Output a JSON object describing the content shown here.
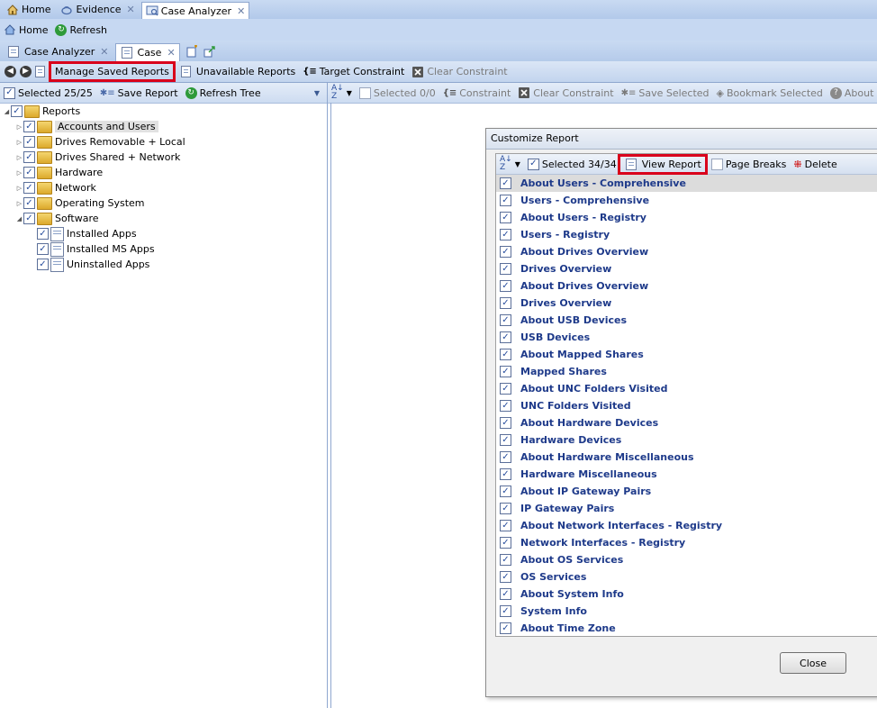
{
  "tabs_top": [
    {
      "label": "Home",
      "icon": "home-icon",
      "closable": false,
      "active": false
    },
    {
      "label": "Evidence",
      "icon": "evidence-icon",
      "closable": true,
      "active": false
    },
    {
      "label": "Case Analyzer",
      "icon": "case-analyzer-icon",
      "closable": true,
      "active": true
    }
  ],
  "home_toolbar": {
    "home_label": "Home",
    "refresh_label": "Refresh"
  },
  "inner_tabs": [
    {
      "label": "Case Analyzer",
      "closable": true
    },
    {
      "label": "Case",
      "closable": true
    }
  ],
  "nav_toolbar": {
    "manage_saved_reports": "Manage Saved Reports",
    "unavailable_reports": "Unavailable Reports",
    "target_constraint": "Target Constraint",
    "clear_constraint": "Clear Constraint"
  },
  "left_toolbar": {
    "selected": "Selected 25/25",
    "save_report": "Save Report",
    "refresh_tree": "Refresh Tree"
  },
  "tree": {
    "root": "Reports",
    "items": [
      {
        "label": "Accounts and Users",
        "selected": true
      },
      {
        "label": "Drives Removable + Local"
      },
      {
        "label": "Drives Shared + Network"
      },
      {
        "label": "Hardware"
      },
      {
        "label": "Network"
      },
      {
        "label": "Operating System"
      },
      {
        "label": "Software"
      }
    ],
    "software_children": [
      "Installed Apps",
      "Installed MS Apps",
      "Uninstalled Apps"
    ]
  },
  "right_toolbar": {
    "selected": "Selected 0/0",
    "constraint": "Constraint",
    "clear_constraint": "Clear Constraint",
    "save_selected": "Save Selected",
    "bookmark_selected": "Bookmark Selected",
    "about": "About"
  },
  "dialog": {
    "title": "Customize Report",
    "selected": "Selected 34/34",
    "view_report": "View Report",
    "page_breaks": "Page Breaks",
    "delete": "Delete",
    "close": "Close",
    "items": [
      "About Users - Comprehensive",
      "Users - Comprehensive",
      "About Users - Registry",
      "Users - Registry",
      "About Drives Overview",
      "Drives Overview",
      "About Drives Overview",
      "Drives Overview",
      "About USB Devices",
      "USB Devices",
      "About Mapped Shares",
      "Mapped Shares",
      "About UNC Folders Visited",
      "UNC Folders Visited",
      "About Hardware Devices",
      "Hardware Devices",
      "About Hardware Miscellaneous",
      "Hardware Miscellaneous",
      "About IP Gateway Pairs",
      "IP Gateway Pairs",
      "About Network Interfaces - Registry",
      "Network Interfaces - Registry",
      "About OS Services",
      "OS Services",
      "About System Info",
      "System Info",
      "About Time Zone"
    ]
  },
  "colors": {
    "highlight": "#d9001b",
    "item_text": "#1e3a8a",
    "chrome": "#c6d8f2"
  }
}
